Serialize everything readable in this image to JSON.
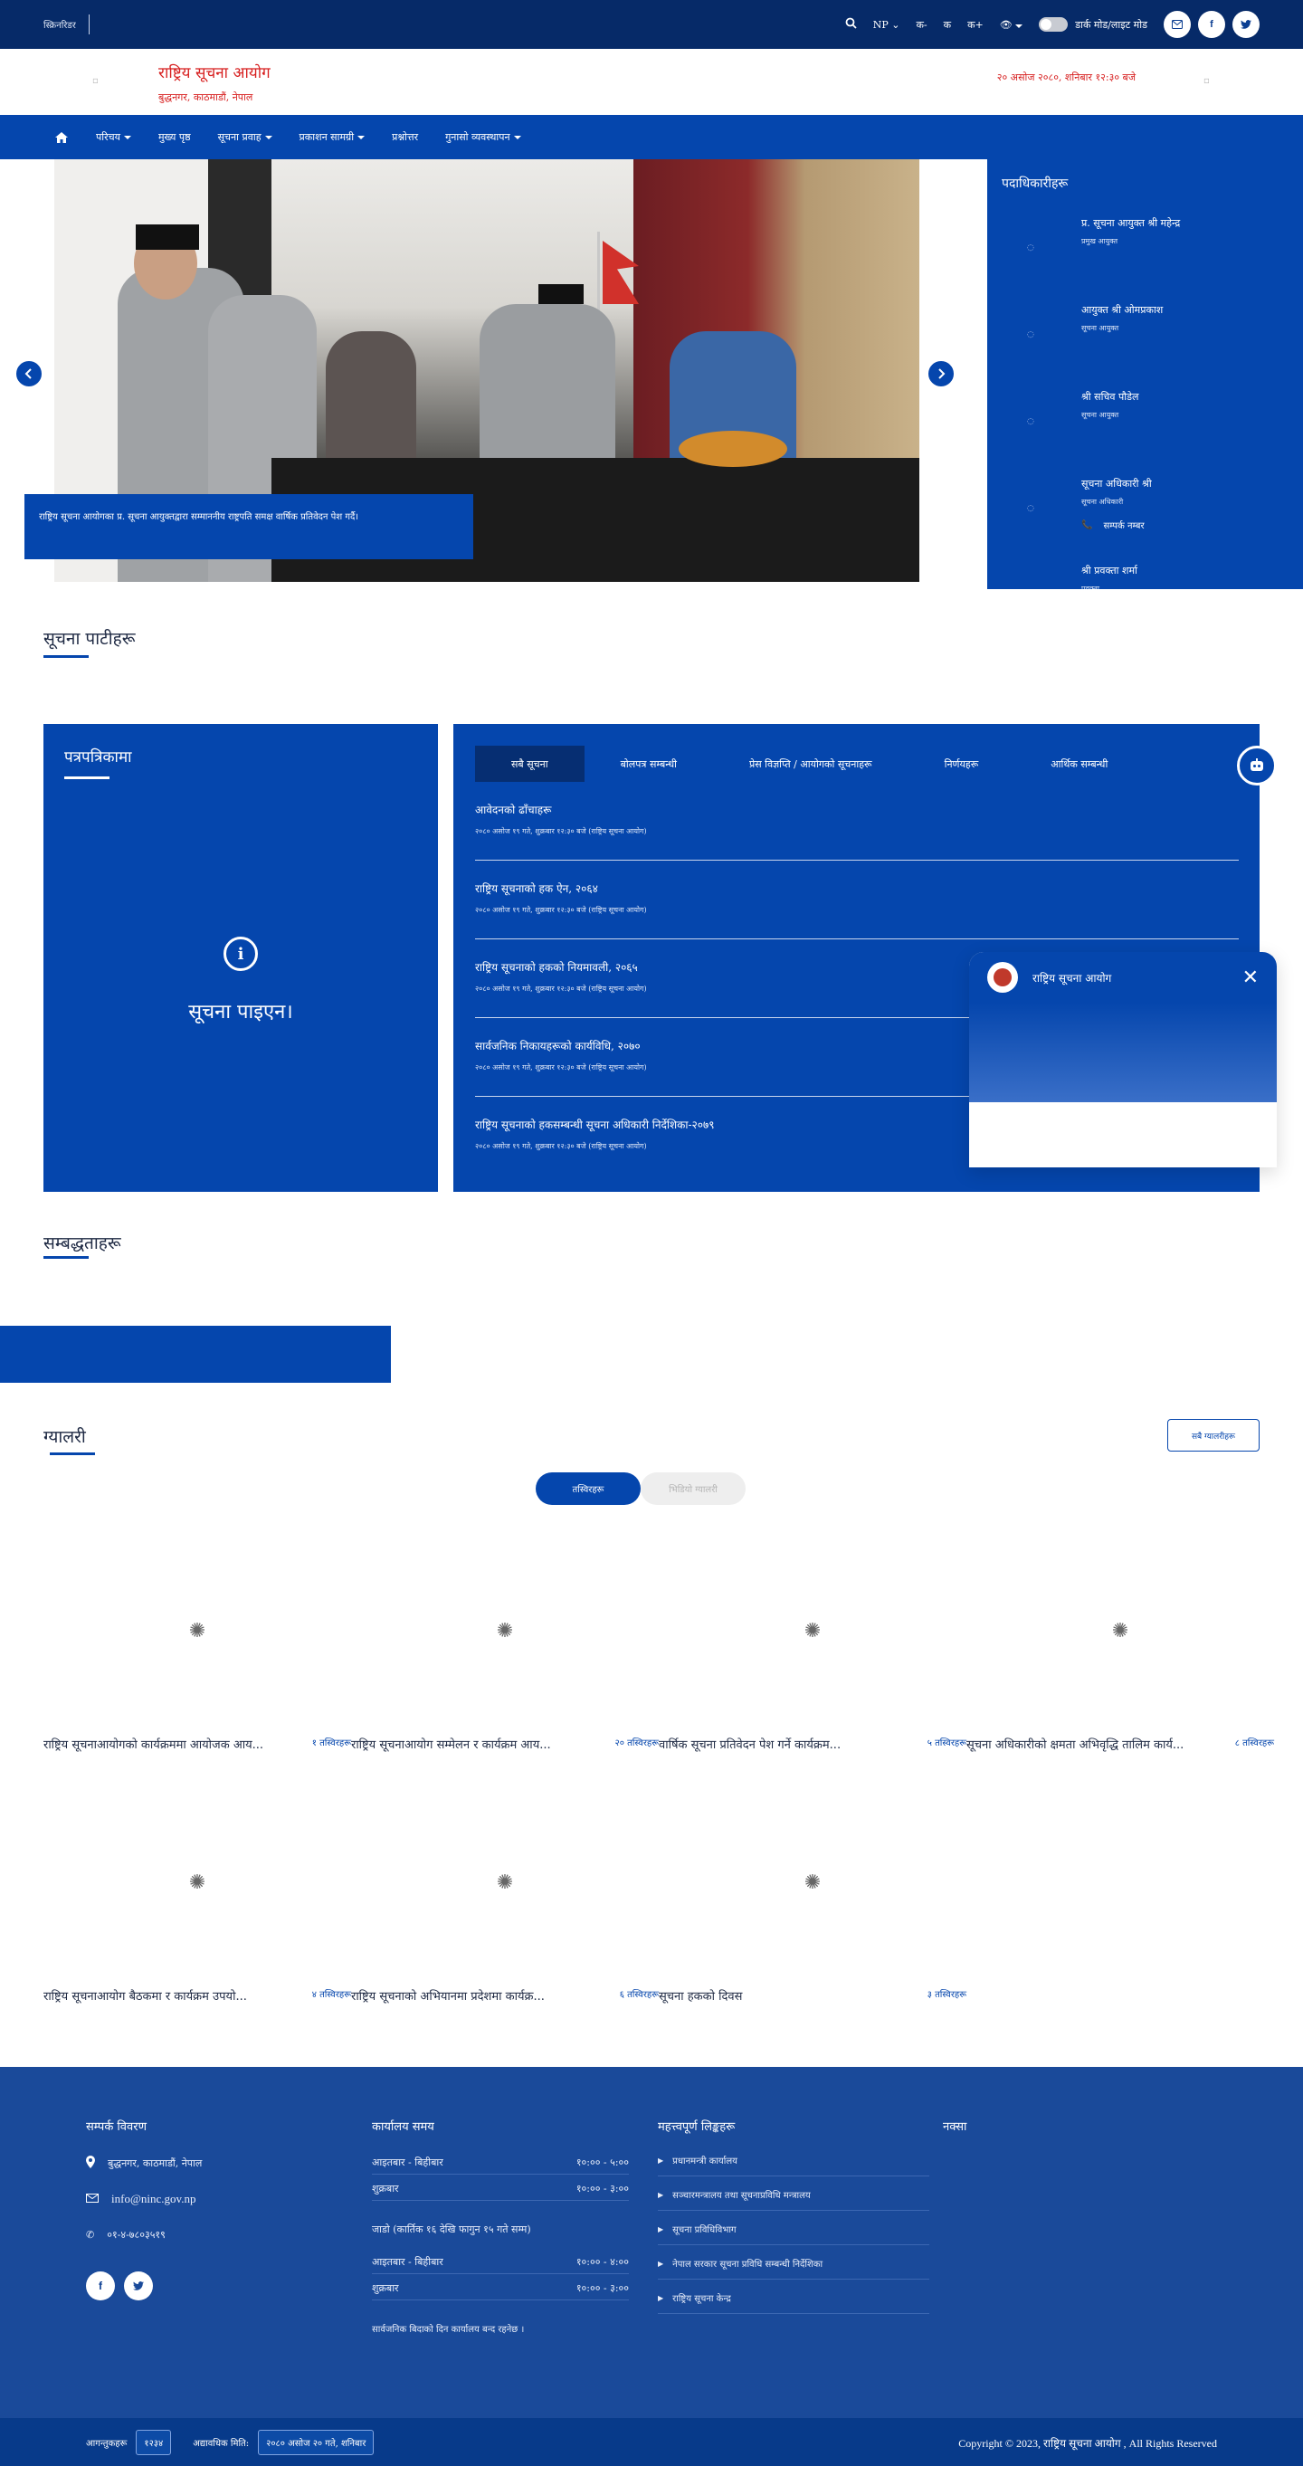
{
  "topbar": {
    "label": "स्क्रिनरिडर",
    "search_icon": "search-icon",
    "language": "NP",
    "font_decrease": "क-",
    "font_reset": "क",
    "font_increase": "क+",
    "dark_mode_label": "डार्क मोड/लाइट मोड"
  },
  "header": {
    "org_name": "राष्ट्रिय सूचना आयोग",
    "address": "बुद्धनगर, काठमाडौं, नेपाल",
    "datetime": "२० असोज २०८०, शनिबार १२:३० बजे"
  },
  "nav": {
    "items": [
      {
        "label": "परिचय",
        "dropdown": true
      },
      {
        "label": "मुख्य पृष्ठ",
        "dropdown": false
      },
      {
        "label": "सूचना प्रवाह",
        "dropdown": true
      },
      {
        "label": "प्रकाशन सामग्री",
        "dropdown": true
      },
      {
        "label": "प्रश्नोत्तर",
        "dropdown": false
      },
      {
        "label": "गुनासो व्यवस्थापन",
        "dropdown": true
      }
    ]
  },
  "hero": {
    "caption": "राष्ट्रिय सूचना आयोगका प्र. सूचना आयुक्तद्वारा सम्माननीय राष्ट्रपति समक्ष वार्षिक प्रतिवेदन पेश गर्दै।"
  },
  "officials": {
    "title": "पदाधिकारीहरू",
    "items": [
      {
        "name": "प्र. सूचना आयुक्त श्री महेन्द्र",
        "designation": "प्रमुख आयुक्त"
      },
      {
        "name": "आयुक्त श्री ओमप्रकाश",
        "designation": "सूचना आयुक्त"
      },
      {
        "name": "श्री सचिव पौडेल",
        "designation": "सूचना आयुक्त"
      },
      {
        "name": "सूचना अधिकारी श्री",
        "designation": "सूचना अधिकारी"
      },
      {
        "name": "श्री प्रवक्ता शर्मा",
        "designation": "प्रवक्ता"
      }
    ],
    "contact_label": "सम्पर्क नम्बर"
  },
  "section_news": {
    "title": "सूचना पाटीहरू"
  },
  "infopanel": {
    "title": "पत्रपत्रिकामा",
    "message": "सूचना पाइएन।"
  },
  "noticepanel": {
    "tabs": [
      {
        "label": "सबै सूचना",
        "active": true
      },
      {
        "label": "बोलपत्र सम्बन्धी",
        "active": false
      },
      {
        "label": "प्रेस विज्ञप्ति / आयोगको सूचनाहरू",
        "active": false
      },
      {
        "label": "निर्णयहरू",
        "active": false
      },
      {
        "label": "आर्थिक सम्बन्धी",
        "active": false
      }
    ],
    "items": [
      {
        "title": "आवेदनको ढाँचाहरू",
        "meta": "२०८० असोज १९ गते, शुक्रबार १२:३० बजे (राष्ट्रिय सूचना आयोग)"
      },
      {
        "title": "राष्ट्रिय सूचनाको हक ऐन, २०६४",
        "meta": "२०८० असोज १९ गते, शुक्रबार १२:३० बजे (राष्ट्रिय सूचना आयोग)"
      },
      {
        "title": "राष्ट्रिय सूचनाको हकको नियमावली, २०६५",
        "meta": "२०८० असोज १९ गते, शुक्रबार १२:३० बजे (राष्ट्रिय सूचना आयोग)"
      },
      {
        "title": "सार्वजनिक निकायहरूको कार्यविधि, २०७०",
        "meta": "२०८० असोज १९ गते, शुक्रबार १२:३० बजे (राष्ट्रिय सूचना आयोग)"
      },
      {
        "title": "राष्ट्रिय सूचनाको हकसम्बन्धी सूचना अधिकारी निर्देशिका-२०७९",
        "meta": "२०८० असोज १९ गते, शुक्रबार १२:३० बजे (राष्ट्रिय सूचना आयोग)"
      }
    ]
  },
  "chat": {
    "title": "राष्ट्रिय सूचना आयोग"
  },
  "section_links": {
    "title": "सम्बद्धताहरू"
  },
  "gallery": {
    "title": "ग्यालरी",
    "view_all": "सबै ग्यालरीहरू",
    "tabs": [
      {
        "label": "तस्विरहरू",
        "active": true
      },
      {
        "label": "भिडियो ग्यालरी",
        "active": false
      }
    ],
    "items": [
      {
        "caption": "राष्ट्रिय सूचनाआयोगको कार्यक्रममा आयोजक आय...",
        "views": "१ तस्विरहरू"
      },
      {
        "caption": "राष्ट्रिय सूचनाआयोग सम्मेलन र कार्यक्रम आय...",
        "views": "२० तस्विरहरू"
      },
      {
        "caption": "वार्षिक सूचना प्रतिवेदन पेश गर्ने कार्यक्रम...",
        "views": "५ तस्विरहरू"
      },
      {
        "caption": "सूचना अधिकारीको क्षमता अभिवृद्धि तालिम कार्य...",
        "views": "८ तस्विरहरू"
      },
      {
        "caption": "राष्ट्रिय सूचनाआयोग बैठकमा र कार्यक्रम उपयो...",
        "views": "४ तस्विरहरू"
      },
      {
        "caption": "राष्ट्रिय सूचनाको अभियानमा प्रदेशमा कार्यक्र...",
        "views": "६ तस्विरहरू"
      },
      {
        "caption": "सूचना हकको दिवस",
        "views": "३ तस्विरहरू"
      }
    ]
  },
  "footer": {
    "contact_title": "सम्पर्क विवरण",
    "address": "बुद्धनगर, काठमाडौं, नेपाल",
    "email": "info@ninc.gov.np",
    "phone": "०१-४-७८०३५१९",
    "hours_title": "कार्यालय समय",
    "hours": [
      {
        "days": "आइतबार - बिहीबार",
        "time": "१०:०० - ५:००"
      },
      {
        "days": "शुक्रबार",
        "time": "१०:०० - ३:००"
      }
    ],
    "winter_title": "जाडो (कार्तिक १६ देखि फागुन १५ गते सम्म)",
    "winter_hours": [
      {
        "days": "आइतबार - बिहीबार",
        "time": "१०:०० - ४:००"
      },
      {
        "days": "शुक्रबार",
        "time": "१०:०० - ३:००"
      }
    ],
    "holiday_note": "सार्वजनिक बिदाको दिन कार्यालय बन्द रहनेछ ।",
    "links_title": "महत्त्वपूर्ण लिङ्कहरू",
    "links": [
      "प्रधानमन्त्री कार्यालय",
      "सञ्चारमन्त्रालय तथा सूचनाप्रविधि मन्त्रालय",
      "सूचना प्रविधिविभाग",
      "नेपाल सरकार सूचना प्रविधि सम्बन्धी निर्देशिका",
      "राष्ट्रिय सूचना केन्द्र"
    ],
    "map_title": "नक्सा"
  },
  "bottombar": {
    "visitors_label": "आगन्तुकहरू",
    "visitors_count": "१२३४",
    "updated_label": "अद्यावधिक मिति:",
    "updated_date": "२०८० असोज २० गते, शनिबार",
    "copyright": "Copyright © 2023, राष्ट्रिय सूचना आयोग , All Rights Reserved"
  }
}
